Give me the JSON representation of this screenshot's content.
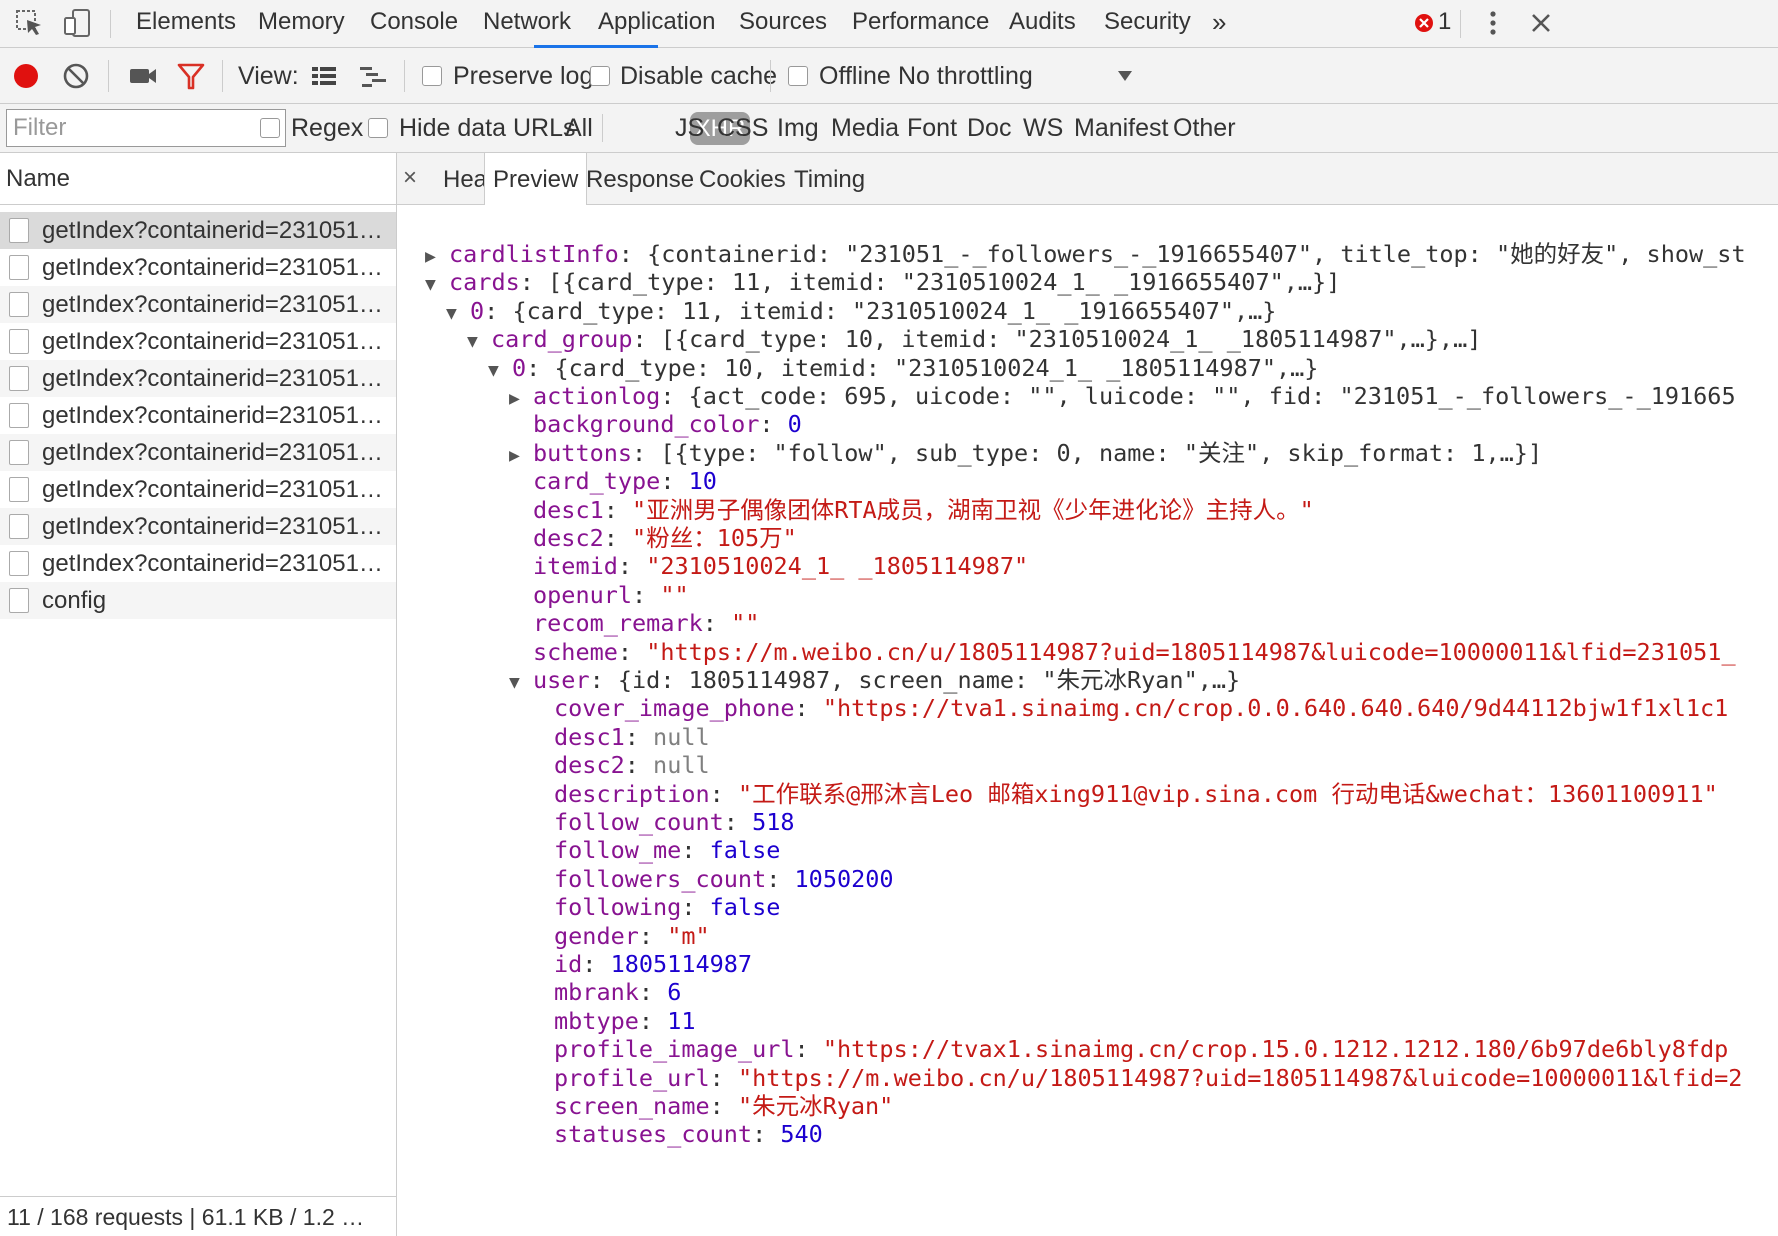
{
  "tabs": [
    "Elements",
    "Memory",
    "Console",
    "Network",
    "Application",
    "Sources",
    "Performance",
    "Audits",
    "Security"
  ],
  "tabs_more": "»",
  "error_count": "1",
  "toolbar": {
    "view_label": "View:",
    "preserve_log": "Preserve log",
    "disable_cache": "Disable cache",
    "offline": "Offline",
    "throttling": "No throttling"
  },
  "filterbar": {
    "placeholder": "Filter",
    "regex": "Regex",
    "hide_data_urls": "Hide data URLs",
    "types": [
      "All",
      "XHR",
      "JS",
      "CSS",
      "Img",
      "Media",
      "Font",
      "Doc",
      "WS",
      "Manifest",
      "Other"
    ]
  },
  "requests": {
    "header": "Name",
    "items": [
      "getIndex?containerid=231051…",
      "getIndex?containerid=231051…",
      "getIndex?containerid=231051…",
      "getIndex?containerid=231051…",
      "getIndex?containerid=231051…",
      "getIndex?containerid=231051…",
      "getIndex?containerid=231051…",
      "getIndex?containerid=231051…",
      "getIndex?containerid=231051…",
      "getIndex?containerid=231051…",
      "config"
    ],
    "status": "11 / 168 requests | 61.1 KB / 1.2 …"
  },
  "detail_tabs": {
    "close": "×",
    "items": [
      "Headers",
      "Preview",
      "Response",
      "Cookies",
      "Timing"
    ],
    "active": "Preview"
  },
  "preview": {
    "lines": [
      {
        "tri": "▶",
        "key": "cardlistInfo",
        "val": "{containerid: \"231051_-_followers_-_1916655407\", title_top: \"她的好友\", show_st",
        "type": "v"
      },
      {
        "tri": "▼",
        "key": "cards",
        "val": "[{card_type: 11, itemid: \"2310510024_1_ _1916655407\",…}]",
        "type": "v"
      },
      {
        "tri": "▼",
        "key": "0",
        "val": "{card_type: 11, itemid: \"2310510024_1_ _1916655407\",…}",
        "type": "v"
      },
      {
        "tri": "▼",
        "key": "card_group",
        "val": "[{card_type: 10, itemid: \"2310510024_1_ _1805114987\",…},…]",
        "type": "v"
      },
      {
        "tri": "▼",
        "key": "0",
        "val": "{card_type: 10, itemid: \"2310510024_1_ _1805114987\",…}",
        "type": "v"
      },
      {
        "tri": "▶",
        "key": "actionlog",
        "val": "{act_code: 695, uicode: \"\", luicode: \"\", fid: \"231051_-_followers_-_191665",
        "type": "v"
      },
      {
        "tri": "",
        "key": "background_color",
        "val": "0",
        "type": "n"
      },
      {
        "tri": "▶",
        "key": "buttons",
        "val": "[{type: \"follow\", sub_type: 0, name: \"关注\", skip_format: 1,…}]",
        "type": "v"
      },
      {
        "tri": "",
        "key": "card_type",
        "val": "10",
        "type": "n"
      },
      {
        "tri": "",
        "key": "desc1",
        "val": "\"亚洲男子偶像团体RTA成员，湖南卫视《少年进化论》主持人。\"",
        "type": "s"
      },
      {
        "tri": "",
        "key": "desc2",
        "val": "\"粉丝：105万\"",
        "type": "s"
      },
      {
        "tri": "",
        "key": "itemid",
        "val": "\"2310510024_1_ _1805114987\"",
        "type": "s"
      },
      {
        "tri": "",
        "key": "openurl",
        "val": "\"\"",
        "type": "s"
      },
      {
        "tri": "",
        "key": "recom_remark",
        "val": "\"\"",
        "type": "s"
      },
      {
        "tri": "",
        "key": "scheme",
        "val": "\"https://m.weibo.cn/u/1805114987?uid=1805114987&luicode=10000011&lfid=231051_",
        "type": "s"
      },
      {
        "tri": "▼",
        "key": "user",
        "val": "{id: 1805114987, screen_name: \"朱元冰Ryan\",…}",
        "type": "v"
      },
      {
        "tri": "",
        "key": "cover_image_phone",
        "val": "\"https://tva1.sinaimg.cn/crop.0.0.640.640.640/9d44112bjw1f1xl1c1",
        "type": "s"
      },
      {
        "tri": "",
        "key": "desc1",
        "val": "null",
        "type": "nl"
      },
      {
        "tri": "",
        "key": "desc2",
        "val": "null",
        "type": "nl"
      },
      {
        "tri": "",
        "key": "description",
        "val": "\"工作联系@邢沐言Leo 邮箱xing911@vip.sina.com 行动电话&wechat：13601100911\"",
        "type": "s"
      },
      {
        "tri": "",
        "key": "follow_count",
        "val": "518",
        "type": "n"
      },
      {
        "tri": "",
        "key": "follow_me",
        "val": "false",
        "type": "n"
      },
      {
        "tri": "",
        "key": "followers_count",
        "val": "1050200",
        "type": "n"
      },
      {
        "tri": "",
        "key": "following",
        "val": "false",
        "type": "n"
      },
      {
        "tri": "",
        "key": "gender",
        "val": "\"m\"",
        "type": "s"
      },
      {
        "tri": "",
        "key": "id",
        "val": "1805114987",
        "type": "n"
      },
      {
        "tri": "",
        "key": "mbrank",
        "val": "6",
        "type": "n"
      },
      {
        "tri": "",
        "key": "mbtype",
        "val": "11",
        "type": "n"
      },
      {
        "tri": "",
        "key": "profile_image_url",
        "val": "\"https://tvax1.sinaimg.cn/crop.15.0.1212.1212.180/6b97de6bly8fdp",
        "type": "s"
      },
      {
        "tri": "",
        "key": "profile_url",
        "val": "\"https://m.weibo.cn/u/1805114987?uid=1805114987&luicode=10000011&lfid=2",
        "type": "s"
      },
      {
        "tri": "",
        "key": "screen_name",
        "val": "\"朱元冰Ryan\"",
        "type": "s"
      },
      {
        "tri": "",
        "key": "statuses_count",
        "val": "540",
        "type": "n"
      }
    ]
  },
  "colors": {
    "accent": "#1a73e8",
    "record": "#e0110f",
    "filter_icon": "#d93025",
    "key": "#881391",
    "string": "#c41a16",
    "number": "#1c00cf"
  }
}
